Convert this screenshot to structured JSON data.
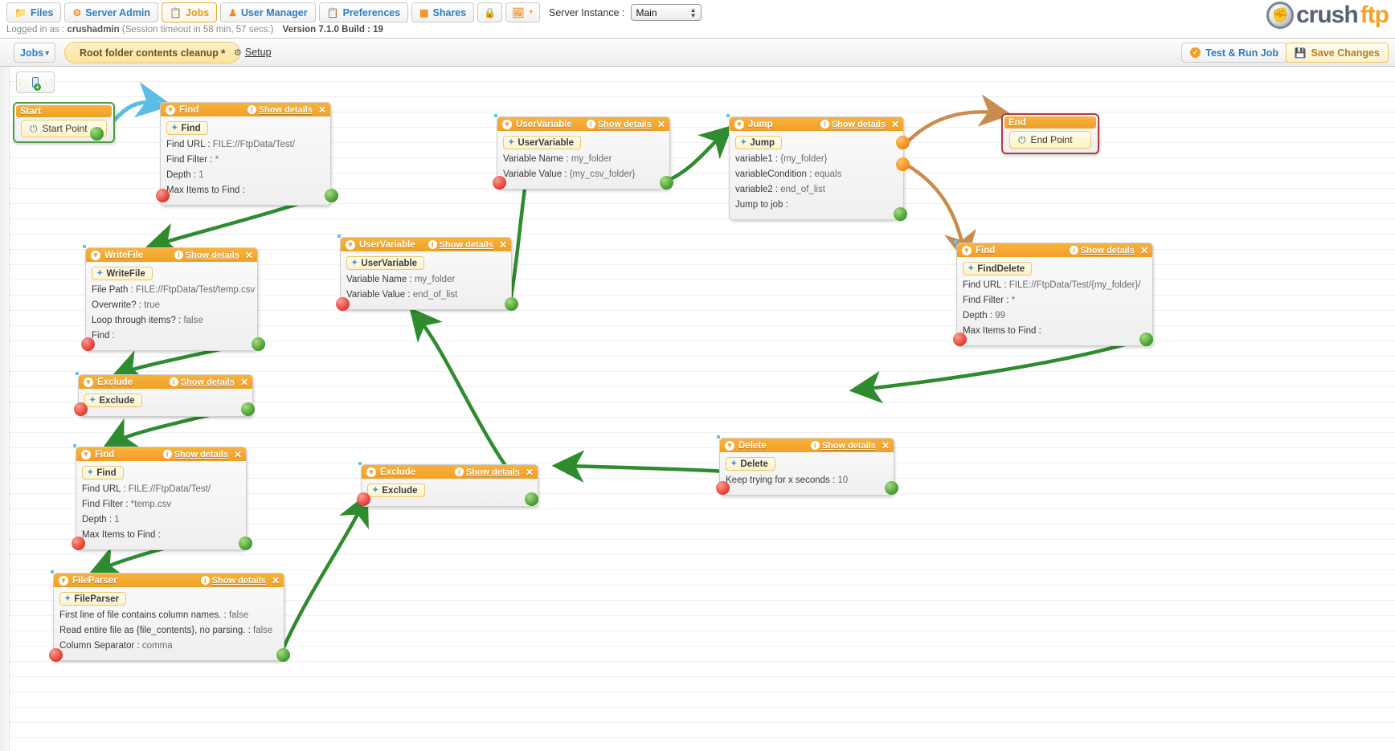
{
  "topbar": {
    "tabs": [
      {
        "label": "Files",
        "icon": "folder-icon",
        "active": false
      },
      {
        "label": "Server Admin",
        "icon": "gear-icon",
        "active": false
      },
      {
        "label": "Jobs",
        "icon": "jobs-icon",
        "active": true
      },
      {
        "label": "User Manager",
        "icon": "user-icon",
        "active": false
      },
      {
        "label": "Preferences",
        "icon": "prefs-icon",
        "active": false
      },
      {
        "label": "Shares",
        "icon": "shares-icon",
        "active": false
      }
    ],
    "lock_icon": "lock-icon",
    "image_icon": "image-icon",
    "login_prefix": "Logged in as :",
    "login_user": "crushadmin",
    "session": "(Session timeout in 58 min, 57 secs.)",
    "version": "Version 7.1.0 Build : 19",
    "instance_label": "Server Instance :",
    "instance_value": "Main",
    "logo_crush": "crush",
    "logo_ftp": "ftp"
  },
  "jobbar": {
    "jobs_label": "Jobs",
    "job_name": "Root folder contents cleanup",
    "job_modified_marker": "*",
    "setup_label": "Setup",
    "test_run_label": "Test & Run Job",
    "save_label": "Save Changes"
  },
  "canvas": {
    "toolbox_tooltip": "add-node"
  },
  "nodes": {
    "start": {
      "title": "Start",
      "point_label": "Start Point"
    },
    "end": {
      "title": "End",
      "point_label": "End Point"
    },
    "find1": {
      "title": "Find",
      "pill": "Find",
      "show_details": "Show details",
      "rows": [
        {
          "k": "Find URL :",
          "v": "FILE://FtpData/Test/"
        },
        {
          "k": "Find Filter :",
          "v": "*"
        },
        {
          "k": "Depth :",
          "v": "1"
        },
        {
          "k": "Max Items to Find :",
          "v": ""
        }
      ]
    },
    "writefile": {
      "title": "WriteFile",
      "pill": "WriteFile",
      "show_details": "Show details",
      "rows": [
        {
          "k": "File Path :",
          "v": "FILE://FtpData/Test/temp.csv"
        },
        {
          "k": "Overwrite? :",
          "v": "true"
        },
        {
          "k": "Loop through items? :",
          "v": "false"
        },
        {
          "k": "Find :",
          "v": ""
        }
      ]
    },
    "exclude1": {
      "title": "Exclude",
      "pill": "Exclude",
      "show_details": "Show details",
      "rows": []
    },
    "find2": {
      "title": "Find",
      "pill": "Find",
      "show_details": "Show details",
      "rows": [
        {
          "k": "Find URL :",
          "v": "FILE://FtpData/Test/"
        },
        {
          "k": "Find Filter :",
          "v": "*temp.csv"
        },
        {
          "k": "Depth :",
          "v": "1"
        },
        {
          "k": "Max Items to Find :",
          "v": ""
        }
      ]
    },
    "fileparser": {
      "title": "FileParser",
      "pill": "FileParser",
      "show_details": "Show details",
      "rows": [
        {
          "k": "First line of file contains column names. :",
          "v": "false"
        },
        {
          "k": "Read entire file as {file_contents}, no parsing. :",
          "v": "false"
        },
        {
          "k": "Column Separator :",
          "v": "comma"
        }
      ]
    },
    "uservar_mid": {
      "title": "UserVariable",
      "pill": "UserVariable",
      "show_details": "Show details",
      "rows": [
        {
          "k": "Variable Name :",
          "v": "my_folder"
        },
        {
          "k": "Variable Value :",
          "v": "end_of_list"
        }
      ]
    },
    "uservar_top": {
      "title": "UserVariable",
      "pill": "UserVariable",
      "show_details": "Show details",
      "rows": [
        {
          "k": "Variable Name :",
          "v": "my_folder"
        },
        {
          "k": "Variable Value :",
          "v": "{my_csv_folder}"
        }
      ]
    },
    "jump": {
      "title": "Jump",
      "pill": "Jump",
      "show_details": "Show details",
      "rows": [
        {
          "k": "variable1 :",
          "v": "{my_folder}"
        },
        {
          "k": "variableCondition :",
          "v": "equals"
        },
        {
          "k": "variable2 :",
          "v": "end_of_list"
        },
        {
          "k": "Jump to job :",
          "v": ""
        }
      ]
    },
    "finddelete": {
      "title": "Find",
      "pill": "FindDelete",
      "show_details": "Show details",
      "rows": [
        {
          "k": "Find URL :",
          "v": "FILE://FtpData/Test/{my_folder}/"
        },
        {
          "k": "Find Filter :",
          "v": "*"
        },
        {
          "k": "Depth :",
          "v": "99"
        },
        {
          "k": "Max Items to Find :",
          "v": ""
        }
      ]
    },
    "exclude2": {
      "title": "Exclude",
      "pill": "Exclude",
      "show_details": "Show details",
      "rows": []
    },
    "delete": {
      "title": "Delete",
      "pill": "Delete",
      "show_details": "Show details",
      "rows": [
        {
          "k": "Keep trying for x seconds :",
          "v": "10"
        }
      ]
    }
  },
  "colors": {
    "header_orange": "#f2a024",
    "link_blue": "#2b7fc4",
    "green_edge": "#2e8b2e",
    "orange_edge": "#c98c4e",
    "blue_edge": "#5bbce4",
    "red_dot": "#e23b2e",
    "green_dot": "#3f9b2f",
    "orange_dot": "#f58a12"
  }
}
